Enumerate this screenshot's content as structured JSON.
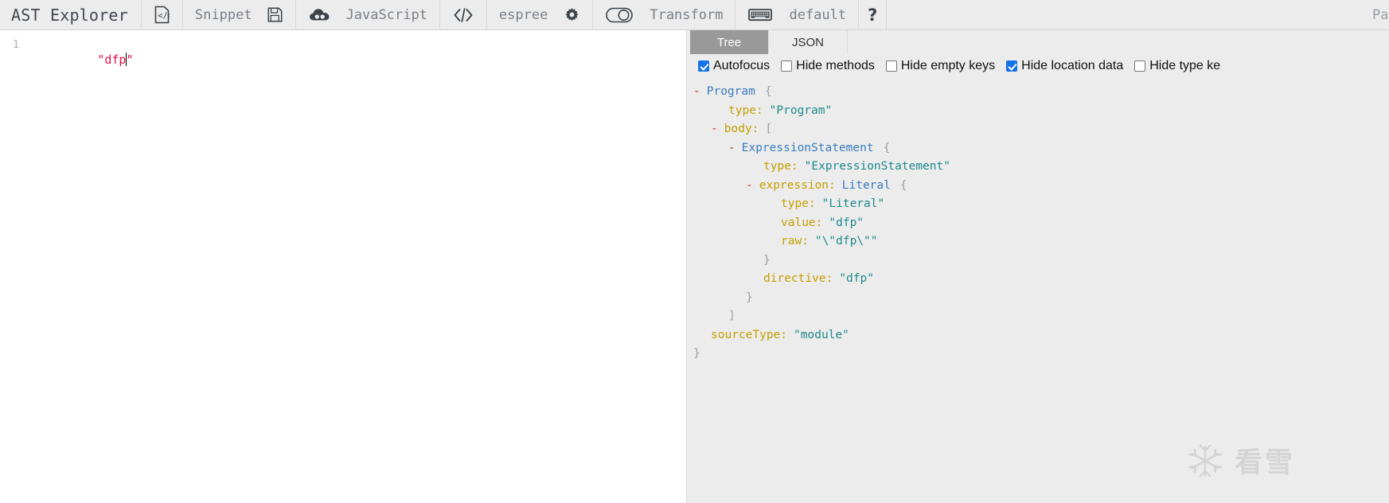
{
  "toolbar": {
    "brand": "AST Explorer",
    "snippet_label": "Snippet",
    "language_label": "JavaScript",
    "parser_label": "espree",
    "transform_label": "Transform",
    "keymap_label": "default",
    "help_label": "?",
    "parser_settings_label": "Pars",
    "icons": {
      "code_file": "code-file-icon",
      "save": "save-icon",
      "cloud": "cloud-icon",
      "code_brackets": "code-brackets-icon",
      "gear": "gear-icon",
      "toggle": "toggle-switch-icon",
      "keyboard": "keyboard-icon"
    }
  },
  "editor": {
    "line_number": "1",
    "quote_open": "\"",
    "value": "dfp",
    "quote_close": "\""
  },
  "panel": {
    "tabs": [
      {
        "label": "Tree",
        "active": true
      },
      {
        "label": "JSON",
        "active": false
      }
    ],
    "options": [
      {
        "label": "Autofocus",
        "checked": true
      },
      {
        "label": "Hide methods",
        "checked": false
      },
      {
        "label": "Hide empty keys",
        "checked": false
      },
      {
        "label": "Hide location data",
        "checked": true
      },
      {
        "label": "Hide type ke",
        "checked": false
      }
    ]
  },
  "tree": [
    {
      "indent": 0,
      "toggle": "-",
      "node": "Program",
      "key": "",
      "value": "",
      "punct": "{",
      "highlight": false
    },
    {
      "indent": 2,
      "toggle": "",
      "node": "",
      "key": "type:",
      "value": "\"Program\"",
      "punct": "",
      "highlight": false
    },
    {
      "indent": 1,
      "toggle": "-",
      "node": "",
      "key": "body:",
      "value": "",
      "punct": "[",
      "highlight": false
    },
    {
      "indent": 2,
      "toggle": "-",
      "node": "ExpressionStatement",
      "key": "",
      "value": "",
      "punct": "{",
      "highlight": false
    },
    {
      "indent": 4,
      "toggle": "",
      "node": "",
      "key": "type:",
      "value": "\"ExpressionStatement\"",
      "punct": "",
      "highlight": false
    },
    {
      "indent": 3,
      "toggle": "-",
      "node": "Literal",
      "key": "expression:",
      "value": "",
      "punct": "{",
      "highlight": true
    },
    {
      "indent": 5,
      "toggle": "",
      "node": "",
      "key": "type:",
      "value": "\"Literal\"",
      "punct": "",
      "highlight": true
    },
    {
      "indent": 5,
      "toggle": "",
      "node": "",
      "key": "value:",
      "value": "\"dfp\"",
      "punct": "",
      "highlight": true
    },
    {
      "indent": 5,
      "toggle": "",
      "node": "",
      "key": "raw:",
      "value": "\"\\\"dfp\\\"\"",
      "punct": "",
      "highlight": true
    },
    {
      "indent": 4,
      "toggle": "",
      "node": "",
      "key": "",
      "value": "",
      "punct": "}",
      "highlight": true
    },
    {
      "indent": 4,
      "toggle": "",
      "node": "",
      "key": "directive:",
      "value": "\"dfp\"",
      "punct": "",
      "highlight": false
    },
    {
      "indent": 3,
      "toggle": "",
      "node": "",
      "key": "",
      "value": "",
      "punct": "}",
      "highlight": false
    },
    {
      "indent": 2,
      "toggle": "",
      "node": "",
      "key": "",
      "value": "",
      "punct": "]",
      "highlight": false
    },
    {
      "indent": 1,
      "toggle": "",
      "node": "",
      "key": "sourceType:",
      "value": "\"module\"",
      "punct": "",
      "highlight": false
    },
    {
      "indent": 0,
      "toggle": "",
      "node": "",
      "key": "",
      "value": "",
      "punct": "}",
      "highlight": false
    }
  ],
  "watermark": {
    "text": "看雪"
  },
  "colors": {
    "accent_checkbox": "#1473e6",
    "tab_active_bg": "#999999",
    "highlight": "#f5ef9f",
    "node_name": "#3a7bbf",
    "key": "#c4a000",
    "string": "#1f8a8a",
    "toggle": "#c0392b",
    "toolbar_bg": "#ececec"
  }
}
